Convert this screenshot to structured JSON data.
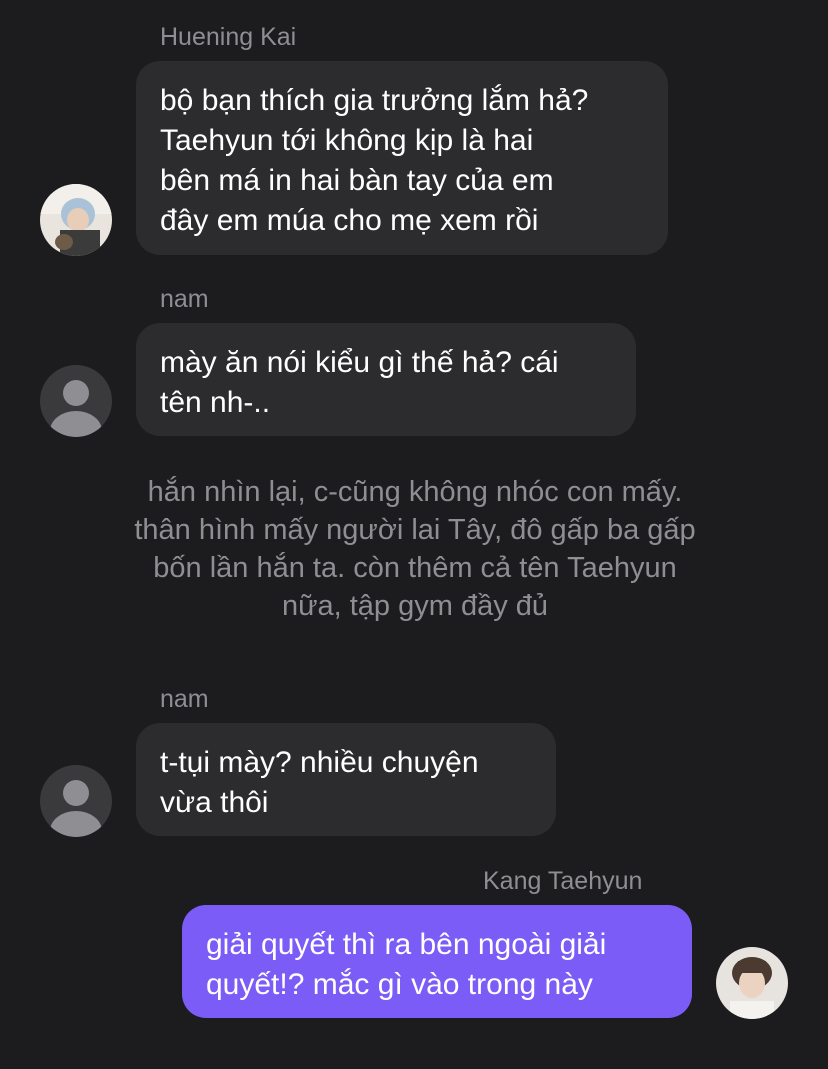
{
  "messages": [
    {
      "sender": "Huening Kai",
      "text": "bộ bạn thích gia trưởng lắm hả?\nTaehyun tới không kịp là hai\nbên má in hai bàn tay của em\nđây em múa cho mẹ xem rồi",
      "direction": "incoming",
      "avatar": "photo-avatar"
    },
    {
      "sender": "nam",
      "text": "mày ăn nói kiểu gì thế hả? cái\ntên nh-..",
      "direction": "incoming",
      "avatar": "default-person-icon"
    },
    {
      "sender": "nam",
      "text": "t-tụi mày? nhiều chuyện\nvừa thôi",
      "direction": "incoming",
      "avatar": "default-person-icon"
    },
    {
      "sender": "Kang Taehyun",
      "text": "giải quyết thì ra bên ngoài giải\nquyết!? mắc gì vào trong này",
      "direction": "outgoing",
      "avatar": "photo-avatar"
    }
  ],
  "narration": "hắn nhìn lại, c-cũng không nhóc con mấy.\nthân hình mấy người lai Tây, đô gấp ba gấp\nbốn lần hắn ta. còn thêm cả tên Taehyun\nnữa, tập gym đầy đủ",
  "colors": {
    "background": "#1c1c1e",
    "incoming_bubble": "#2c2c2e",
    "outgoing_bubble": "#7b5cf7",
    "sender_text": "#8e8e93"
  }
}
